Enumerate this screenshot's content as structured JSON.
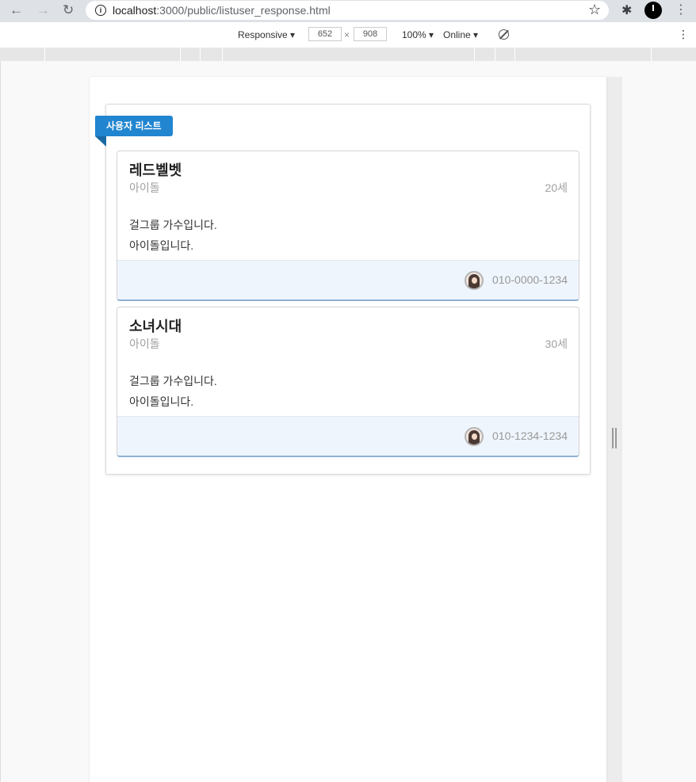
{
  "browser": {
    "url_host": "localhost",
    "url_path": ":3000/public/listuser_response.html"
  },
  "devtools": {
    "device": "Responsive",
    "width": "652",
    "times": "×",
    "height": "908",
    "zoom": "100%",
    "network": "Online"
  },
  "page": {
    "ribbon_label": "사용자 리스트",
    "users": [
      {
        "name": "레드벨벳",
        "category": "아이돌",
        "age": "20세",
        "desc_line1": "걸그룹 가수입니다.",
        "desc_line2": "아이돌입니다.",
        "phone": "010-0000-1234"
      },
      {
        "name": "소녀시대",
        "category": "아이돌",
        "age": "30세",
        "desc_line1": "걸그룹 가수입니다.",
        "desc_line2": "아이돌입니다.",
        "phone": "010-1234-1234"
      }
    ]
  },
  "colors": {
    "ribbon": "#2185d0",
    "card_extra_bg": "#eef5fd"
  }
}
